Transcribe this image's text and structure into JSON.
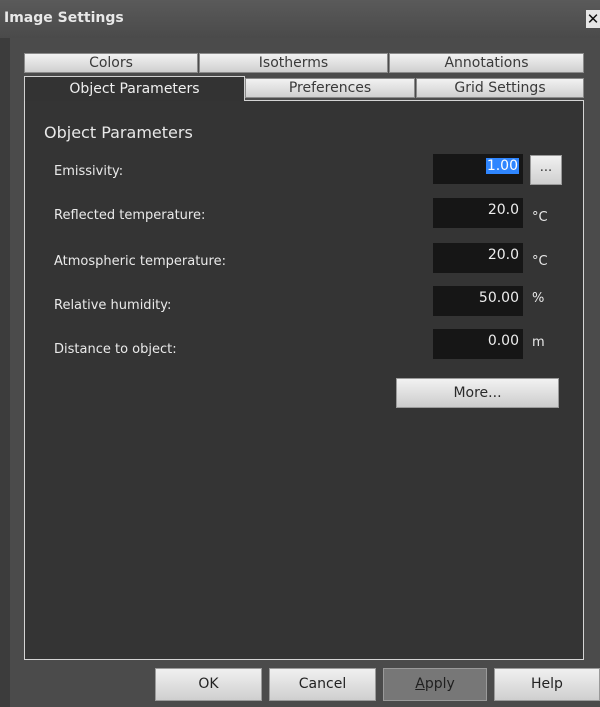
{
  "window": {
    "title": "Image Settings",
    "close_glyph": "✕"
  },
  "tabs": {
    "row1": [
      "Colors",
      "Isotherms",
      "Annotations"
    ],
    "row2": [
      "Object Parameters",
      "Preferences",
      "Grid Settings"
    ],
    "active": "Object Parameters"
  },
  "section": {
    "title": "Object Parameters"
  },
  "fields": {
    "emissivity": {
      "label": "Emissivity:",
      "value": "1.00",
      "button": "..."
    },
    "reflected": {
      "label": "Reflected temperature:",
      "value": "20.0",
      "unit": "°C"
    },
    "atmospheric": {
      "label": "Atmospheric temperature:",
      "value": "20.0",
      "unit": "°C"
    },
    "humidity": {
      "label": "Relative humidity:",
      "value": "50.00",
      "unit": "%"
    },
    "distance": {
      "label": "Distance to object:",
      "value": "0.00",
      "unit": "m"
    }
  },
  "more_button": "More...",
  "buttons": {
    "ok": "OK",
    "cancel": "Cancel",
    "apply_accel": "A",
    "apply_rest": "pply",
    "help": "Help"
  },
  "colors": {
    "background": "#343434",
    "selection": "#2f86ff"
  }
}
